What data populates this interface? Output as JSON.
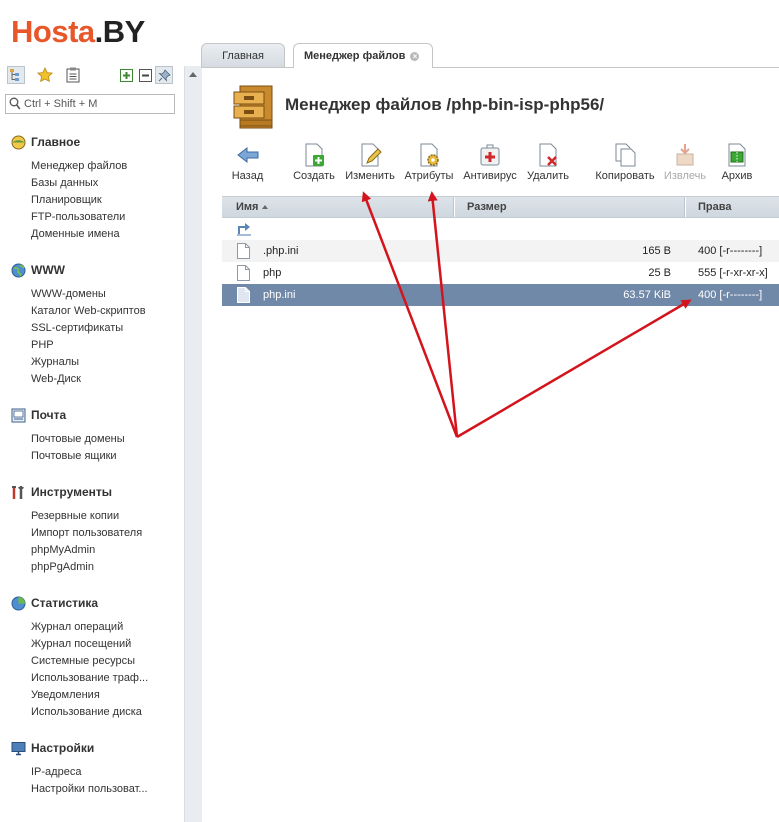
{
  "brand": {
    "part1": "Hosta",
    "part2": ".BY"
  },
  "search": {
    "placeholder": "Ctrl + Shift + M"
  },
  "side_tools": [
    "tree-icon",
    "star-icon",
    "clipboard-icon",
    "expand-all-icon",
    "collapse-all-icon",
    "pin-icon"
  ],
  "menu": [
    {
      "title": "Главное",
      "icon": "home-globe-icon",
      "items": [
        "Менеджер файлов",
        "Базы данных",
        "Планировщик",
        "FTP-пользователи",
        "Доменные имена"
      ]
    },
    {
      "title": "WWW",
      "icon": "globe-icon",
      "items": [
        "WWW-домены",
        "Каталог Web-скриптов",
        "SSL-сертификаты",
        "PHP",
        "Журналы",
        "Web-Диск"
      ]
    },
    {
      "title": "Почта",
      "icon": "mail-icon",
      "items": [
        "Почтовые домены",
        "Почтовые ящики"
      ]
    },
    {
      "title": "Инструменты",
      "icon": "tools-icon",
      "items": [
        "Резервные копии",
        "Импорт пользователя",
        "phpMyAdmin",
        "phpPgAdmin"
      ]
    },
    {
      "title": "Статистика",
      "icon": "pie-chart-icon",
      "items": [
        "Журнал операций",
        "Журнал посещений",
        "Системные ресурсы",
        "Использование траф...",
        "Уведомления",
        "Использование диска"
      ]
    },
    {
      "title": "Настройки",
      "icon": "monitor-icon",
      "items": [
        "IP-адреса",
        "Настройки пользоват..."
      ]
    }
  ],
  "tabs": [
    {
      "label": "Главная",
      "active": false
    },
    {
      "label": "Менеджер файлов",
      "active": true,
      "closable": true
    }
  ],
  "page": {
    "title": "Менеджер файлов /php-bin-isp-php56/"
  },
  "toolbar": [
    {
      "label": "Назад",
      "icon": "back-arrow-icon",
      "enabled": true
    },
    {
      "label": "Создать",
      "icon": "create-file-icon",
      "enabled": true
    },
    {
      "label": "Изменить",
      "icon": "edit-file-icon",
      "enabled": true
    },
    {
      "label": "Атрибуты",
      "icon": "attributes-gear-icon",
      "enabled": true
    },
    {
      "label": "Антивирус",
      "icon": "antivirus-icon",
      "enabled": true
    },
    {
      "label": "Удалить",
      "icon": "delete-file-icon",
      "enabled": true
    },
    {
      "label": "Копировать",
      "icon": "copy-icon",
      "enabled": true
    },
    {
      "label": "Извлечь",
      "icon": "extract-icon",
      "enabled": false
    },
    {
      "label": "Архив",
      "icon": "archive-icon",
      "enabled": true
    }
  ],
  "table": {
    "columns": [
      "Имя",
      "Размер",
      "Права"
    ],
    "sort_column": "Имя",
    "rows": [
      {
        "name": ".php.ini",
        "size": "165 B",
        "perms": "400 [-r--------]",
        "selected": false
      },
      {
        "name": "php",
        "size": "25 B",
        "perms": "555 [-r-xr-xr-x]",
        "selected": false
      },
      {
        "name": "php.ini",
        "size": "63.57 KiB",
        "perms": "400 [-r--------]",
        "selected": true
      }
    ]
  },
  "colors": {
    "brand_orange": "#e8572a",
    "selected_row": "#7189a9",
    "annotation_arrow": "#d4141c"
  }
}
